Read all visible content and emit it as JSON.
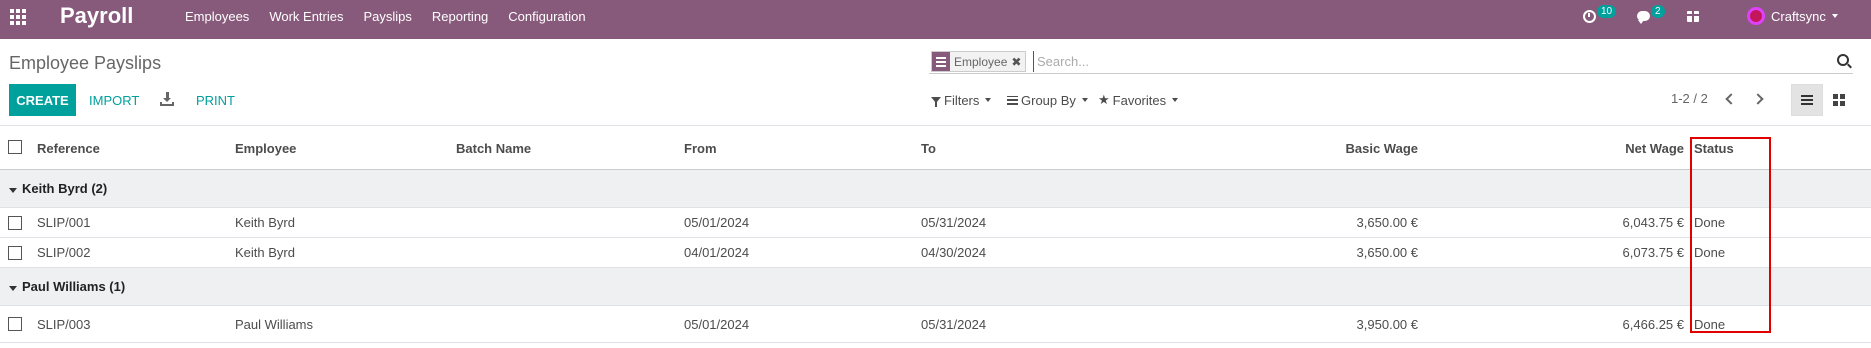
{
  "navbar": {
    "apps_icon": "apps-grid-icon",
    "app_name": "Payroll",
    "menu": [
      "Employees",
      "Work Entries",
      "Payslips",
      "Reporting",
      "Configuration"
    ],
    "activity_count": "10",
    "messages_count": "2",
    "company": "Craftsync"
  },
  "control_panel": {
    "breadcrumb": "Employee Payslips",
    "search": {
      "facet_value": "Employee",
      "placeholder": "Search..."
    },
    "buttons": {
      "create": "CREATE",
      "import": "IMPORT",
      "print": "PRINT"
    },
    "filters": "Filters",
    "group_by": "Group By",
    "favorites": "Favorites",
    "pager": "1-2 / 2"
  },
  "table": {
    "columns": [
      "Reference",
      "Employee",
      "Batch Name",
      "From",
      "To",
      "Basic Wage",
      "Net Wage",
      "Status"
    ],
    "groups": [
      {
        "label": "Keith Byrd (2)",
        "rows": [
          {
            "reference": "SLIP/001",
            "employee": "Keith Byrd",
            "batch": "",
            "from": "05/01/2024",
            "to": "05/31/2024",
            "basic_wage": "3,650.00 €",
            "net_wage": "6,043.75 €",
            "status": "Done"
          },
          {
            "reference": "SLIP/002",
            "employee": "Keith Byrd",
            "batch": "",
            "from": "04/01/2024",
            "to": "04/30/2024",
            "basic_wage": "3,650.00 €",
            "net_wage": "6,073.75 €",
            "status": "Done"
          }
        ]
      },
      {
        "label": "Paul Williams (1)",
        "rows": [
          {
            "reference": "SLIP/003",
            "employee": "Paul Williams",
            "batch": "",
            "from": "05/01/2024",
            "to": "05/31/2024",
            "basic_wage": "3,950.00 €",
            "net_wage": "6,466.25 €",
            "status": "Done"
          }
        ]
      }
    ]
  },
  "colors": {
    "navbar": "#875a7b",
    "primary": "#00a09d",
    "group_row": "#eef0f2",
    "highlight_box": "#e00000"
  }
}
